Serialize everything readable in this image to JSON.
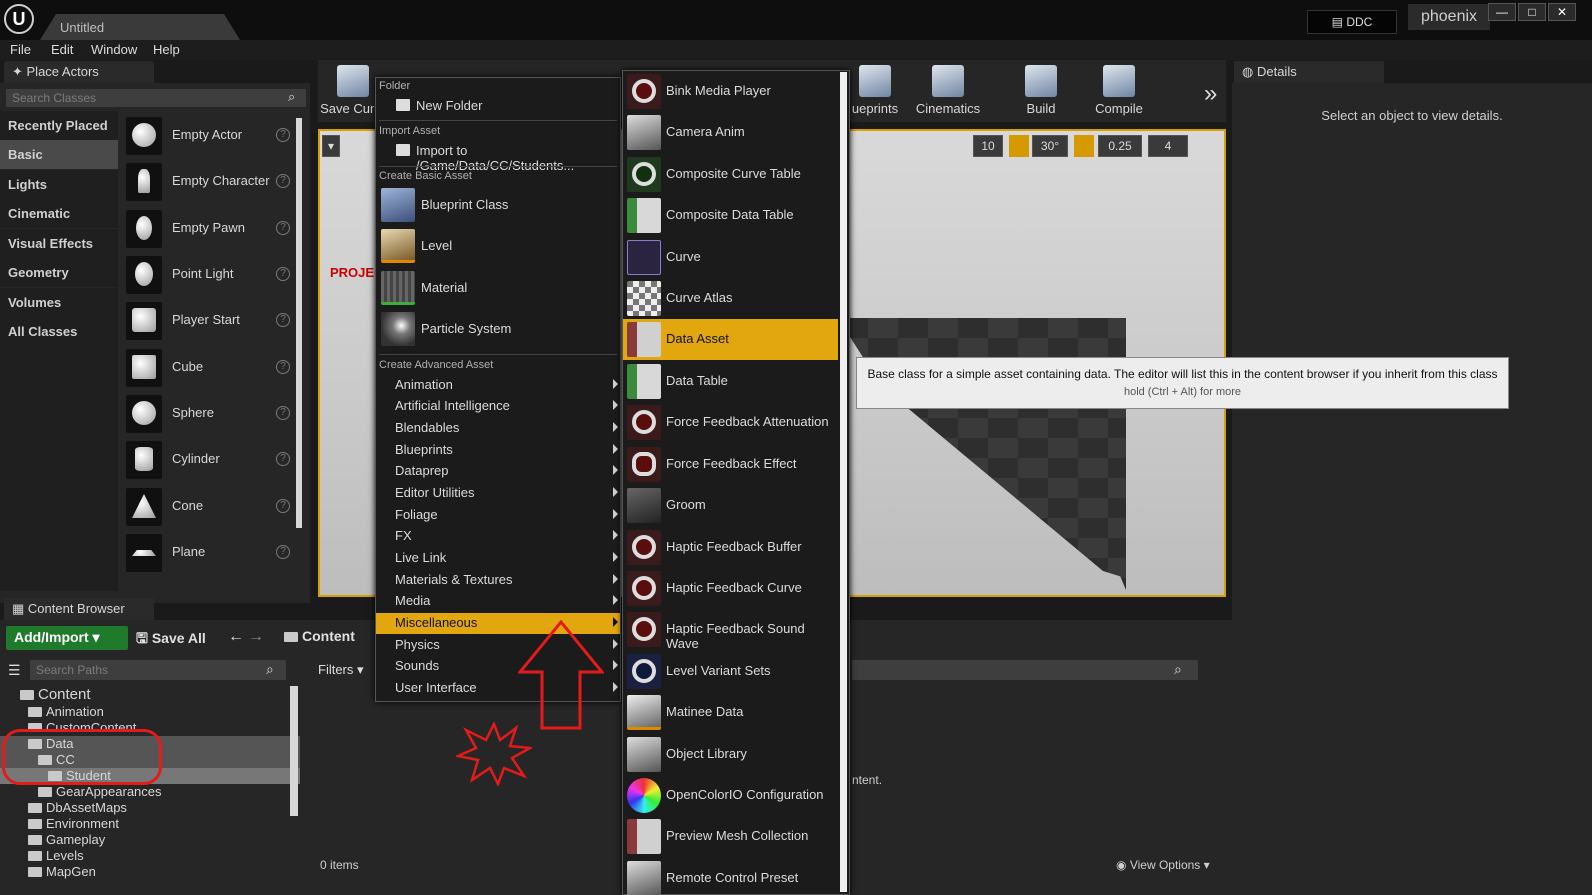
{
  "window": {
    "doc_tab": "Untitled",
    "ddc_label": "DDC",
    "user": "phoenix",
    "min": "—",
    "max": "□",
    "close": "✕"
  },
  "menubar": [
    "File",
    "Edit",
    "Window",
    "Help"
  ],
  "place_actors": {
    "tab_label": "Place Actors",
    "search_placeholder": "Search Classes",
    "categories": [
      "Recently Placed",
      "Basic",
      "Lights",
      "Cinematic",
      "Visual Effects",
      "Geometry",
      "Volumes",
      "All Classes"
    ],
    "selected_category": "Basic",
    "items": [
      "Empty Actor",
      "Empty Character",
      "Empty Pawn",
      "Point Light",
      "Player Start",
      "Cube",
      "Sphere",
      "Cylinder",
      "Cone",
      "Plane"
    ],
    "help_glyph": "?"
  },
  "toolbar": {
    "buttons": [
      "Save Curre",
      "ueprints",
      "Cinematics",
      "Build",
      "Compile"
    ],
    "more": "»"
  },
  "viewport": {
    "grid_snap": "10",
    "rot_snap": "30°",
    "scale_snap": "0.25",
    "cam_speed": "4",
    "project_label": "PROJECT"
  },
  "details": {
    "tab_label": "Details",
    "empty_msg": "Select an object to view details."
  },
  "content_browser": {
    "tab_label": "Content Browser",
    "add_import": "Add/Import ▾",
    "save_all": "Save All",
    "crumb": "Content",
    "paths_placeholder": "Search Paths",
    "filters": "Filters ▾",
    "items_count": "0 items",
    "view_options": "View Options ▾",
    "partial_text": "ntent.",
    "tree": [
      {
        "label": "Content",
        "indent": 0
      },
      {
        "label": "Animation",
        "indent": 1
      },
      {
        "label": "CustomContent",
        "indent": 1
      },
      {
        "label": "Data",
        "indent": 1
      },
      {
        "label": "CC",
        "indent": 2
      },
      {
        "label": "Student",
        "indent": 3
      },
      {
        "label": "GearAppearances",
        "indent": 2
      },
      {
        "label": "DbAssetMaps",
        "indent": 1
      },
      {
        "label": "Environment",
        "indent": 1
      },
      {
        "label": "Gameplay",
        "indent": 1
      },
      {
        "label": "Levels",
        "indent": 1
      },
      {
        "label": "MapGen",
        "indent": 1
      }
    ]
  },
  "context_menu": {
    "folder_header": "Folder",
    "new_folder": "New Folder",
    "import_header": "Import Asset",
    "import_to": "Import to /Game/Data/CC/Students...",
    "basic_header": "Create Basic Asset",
    "basic_items": [
      "Blueprint Class",
      "Level",
      "Material",
      "Particle System"
    ],
    "advanced_header": "Create Advanced Asset",
    "advanced_items": [
      "Animation",
      "Artificial Intelligence",
      "Blendables",
      "Blueprints",
      "Dataprep",
      "Editor Utilities",
      "Foliage",
      "FX",
      "Live Link",
      "Materials & Textures",
      "Media",
      "Miscellaneous",
      "Physics",
      "Sounds",
      "User Interface"
    ],
    "highlighted": "Miscellaneous"
  },
  "submenu": {
    "items": [
      "Bink Media Player",
      "Camera Anim",
      "Composite Curve Table",
      "Composite Data Table",
      "Curve",
      "Curve Atlas",
      "Data Asset",
      "Data Table",
      "Force Feedback Attenuation",
      "Force Feedback Effect",
      "Groom",
      "Haptic Feedback Buffer",
      "Haptic Feedback Curve",
      "Haptic Feedback Sound Wave",
      "Level Variant Sets",
      "Matinee Data",
      "Object Library",
      "OpenColorIO Configuration",
      "Preview Mesh Collection",
      "Remote Control Preset"
    ],
    "highlighted": "Data Asset"
  },
  "tooltip": {
    "main": "Base class for a simple asset containing data. The editor will list this in the content browser if you inherit from this class",
    "sub": "hold (Ctrl + Alt) for more"
  },
  "colors": {
    "highlight": "#e2a60f",
    "annotation": "#e21b1b",
    "add_button": "#1f7a2b"
  }
}
